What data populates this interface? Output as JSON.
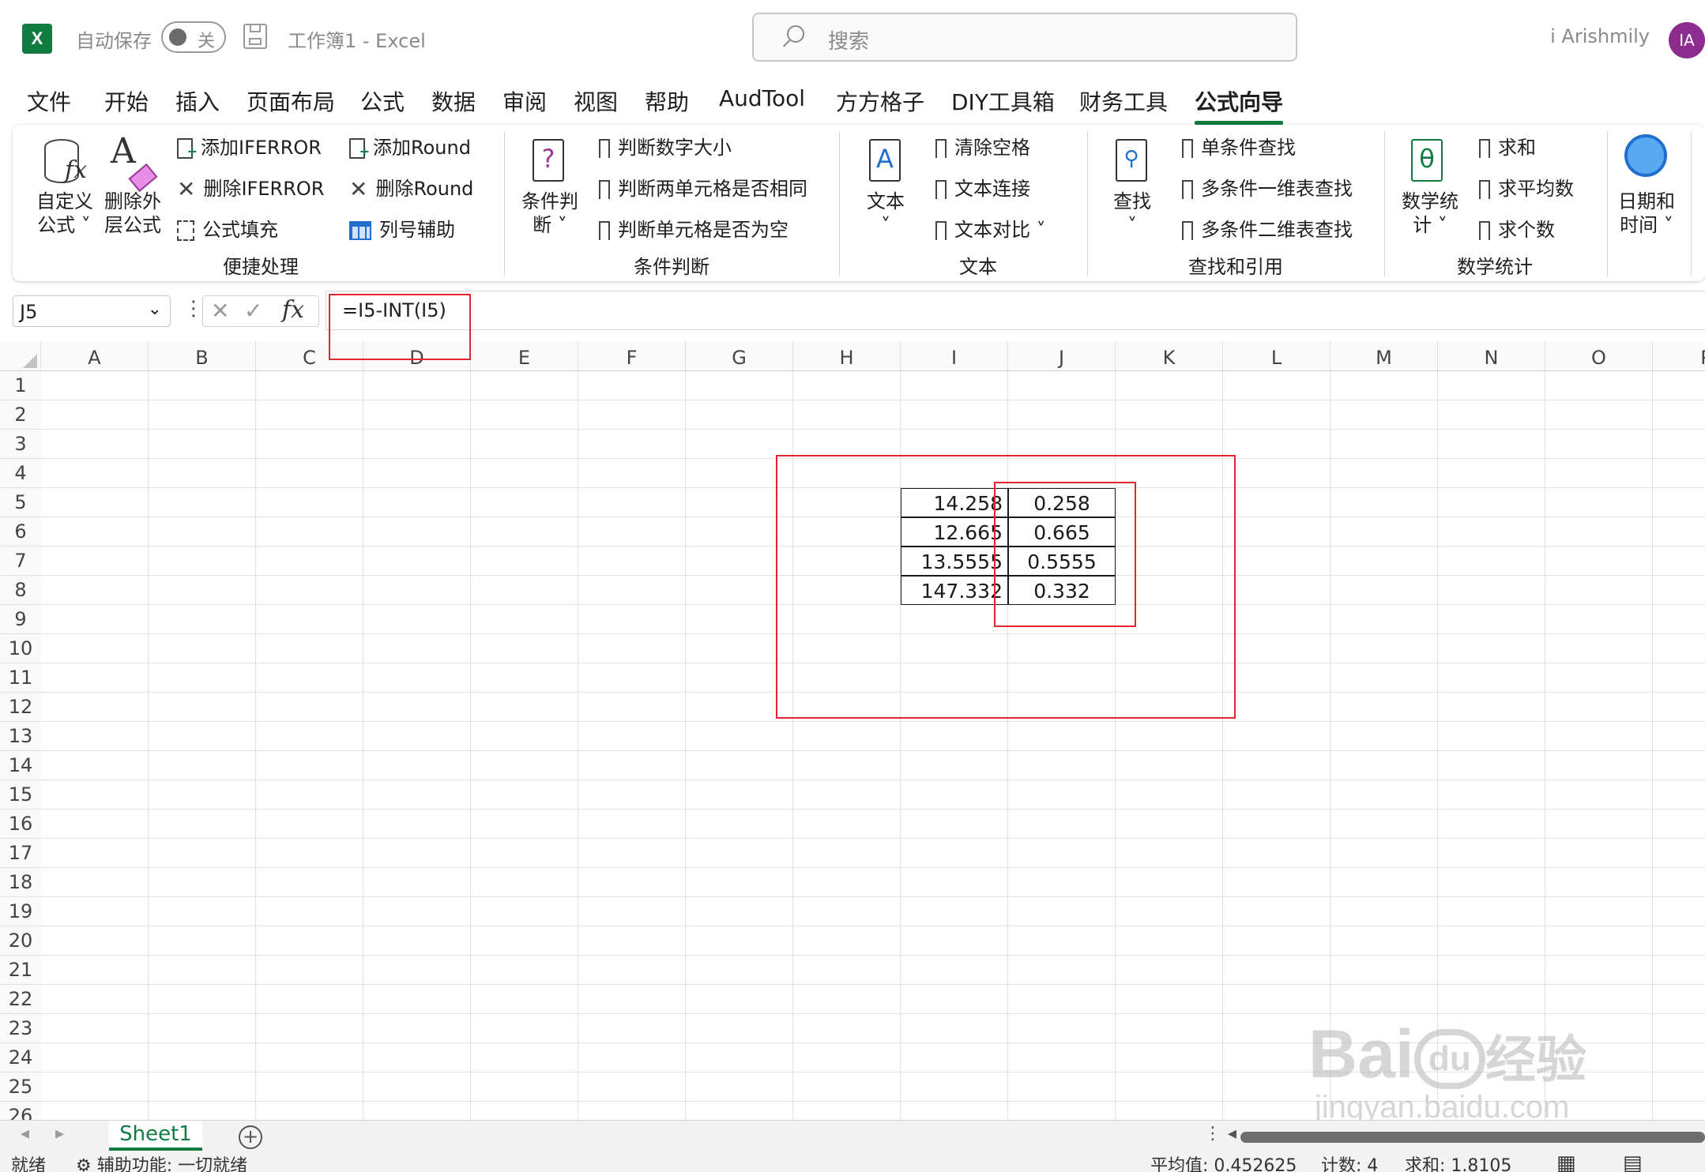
{
  "titlebar": {
    "app_icon": "X",
    "autosave_label": "自动保存",
    "autosave_state": "关",
    "doc_title": "工作簿1  -  Excel",
    "search_placeholder": "搜索",
    "user_name": "i Arishmily",
    "avatar_initials": "IA"
  },
  "menu": {
    "tabs": [
      "文件",
      "开始",
      "插入",
      "页面布局",
      "公式",
      "数据",
      "审阅",
      "视图",
      "帮助",
      "AudTool",
      "方方格子",
      "DIY工具箱",
      "财务工具",
      "公式向导"
    ],
    "active": "公式向导"
  },
  "ribbon": {
    "groups": {
      "quick": {
        "label": "便捷处理",
        "custom_formula": "自定义\n公式 ˅",
        "remove_outer": "删除外\n层公式",
        "add_iferror": "添加IFERROR",
        "del_iferror": "删除IFERROR",
        "formula_fill": "公式填充",
        "add_round": "添加Round",
        "del_round": "删除Round",
        "col_assist": "列号辅助"
      },
      "condition": {
        "label": "条件判断",
        "big": "条件判\n断 ˅",
        "item1": "判断数字大小",
        "item2": "判断两单元格是否相同",
        "item3": "判断单元格是否为空"
      },
      "text": {
        "label": "文本",
        "big": "文本\n˅",
        "item1": "清除空格",
        "item2": "文本连接",
        "item3": "文本对比  ˅"
      },
      "lookup": {
        "label": "查找和引用",
        "big": "查找\n˅",
        "item1": "单条件查找",
        "item2": "多条件一维表查找",
        "item3": "多条件二维表查找"
      },
      "math": {
        "label": "数学统计",
        "big": "数学统\n计 ˅",
        "item1": "求和",
        "item2": "求平均数",
        "item3": "求个数"
      },
      "date": {
        "big": "日期和\n时间 ˅"
      }
    }
  },
  "formula_bar": {
    "name_box": "J5",
    "formula": "=I5-INT(I5)",
    "cancel": "✕",
    "confirm": "✓",
    "fx": "fx"
  },
  "grid": {
    "columns": [
      "A",
      "B",
      "C",
      "D",
      "E",
      "F",
      "G",
      "H",
      "I",
      "J",
      "K",
      "L",
      "M",
      "N",
      "O",
      "P"
    ],
    "rows": [
      "1",
      "2",
      "3",
      "4",
      "5",
      "6",
      "7",
      "8",
      "9",
      "10",
      "11",
      "12",
      "13",
      "14",
      "15",
      "16",
      "17",
      "18",
      "19",
      "20",
      "21",
      "22",
      "23",
      "24",
      "25",
      "26"
    ],
    "cells": [
      {
        "ref": "I5",
        "value": "14.258"
      },
      {
        "ref": "I6",
        "value": "12.665"
      },
      {
        "ref": "I7",
        "value": "13.5555"
      },
      {
        "ref": "I8",
        "value": "147.332"
      },
      {
        "ref": "J5",
        "value": "0.258"
      },
      {
        "ref": "J6",
        "value": "0.665"
      },
      {
        "ref": "J7",
        "value": "0.5555"
      },
      {
        "ref": "J8",
        "value": "0.332"
      }
    ]
  },
  "sheets": {
    "tabs": [
      "Sheet1"
    ],
    "add": "+"
  },
  "statusbar": {
    "ready": "就绪",
    "accessibility": "辅助功能: 一切就绪",
    "average": "平均值: 0.452625",
    "count": "计数: 4",
    "sum": "求和: 1.8105"
  },
  "watermark": {
    "brand": "Bai",
    "paw": "du",
    "jingyan": "经验",
    "url": "jingyan.baidu.com"
  },
  "colors": {
    "excel_green": "#107c41",
    "annotation_red": "#e0282e",
    "avatar": "#8d2c8f"
  }
}
